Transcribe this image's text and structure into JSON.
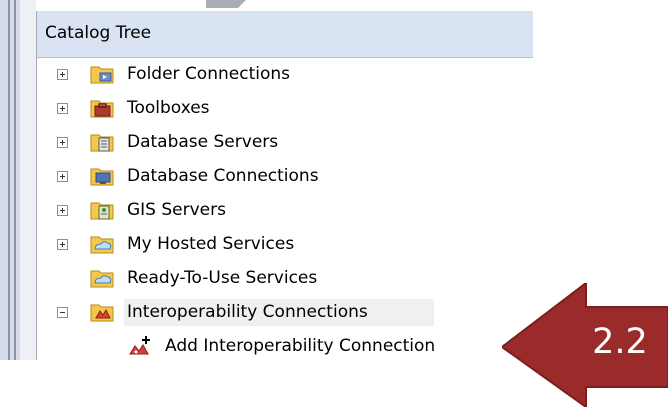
{
  "panel": {
    "title": "Catalog Tree"
  },
  "tree": {
    "items": [
      {
        "label": "Folder Connections",
        "icon": "folder-connections-icon",
        "expander": "plus"
      },
      {
        "label": "Toolboxes",
        "icon": "toolboxes-icon",
        "expander": "plus"
      },
      {
        "label": "Database Servers",
        "icon": "database-servers-icon",
        "expander": "plus"
      },
      {
        "label": "Database Connections",
        "icon": "database-connections-icon",
        "expander": "plus"
      },
      {
        "label": "GIS Servers",
        "icon": "gis-servers-icon",
        "expander": "plus"
      },
      {
        "label": "My Hosted Services",
        "icon": "hosted-services-icon",
        "expander": "plus"
      },
      {
        "label": "Ready-To-Use Services",
        "icon": "ready-to-use-services-icon",
        "expander": "none"
      },
      {
        "label": "Interoperability Connections",
        "icon": "interoperability-connections-icon",
        "expander": "minus"
      },
      {
        "label": "Add Interoperability Connection",
        "icon": "add-interoperability-connection-icon",
        "expander": "none"
      }
    ]
  },
  "callout": {
    "label": "2.2",
    "color": "#9b2a2b"
  },
  "colors": {
    "header_bg": "#d9e3f2",
    "selected_bg": "#f0f0f0",
    "folder_yellow": "#f2c94c"
  }
}
